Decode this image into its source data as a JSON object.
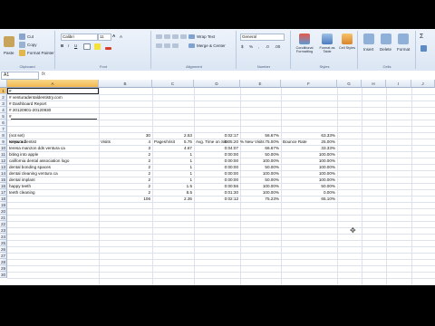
{
  "ribbon": {
    "clipboard": {
      "paste": "Paste",
      "cut": "Cut",
      "copy": "Copy",
      "format_painter": "Format Painter",
      "label": "Clipboard"
    },
    "font": {
      "name": "Calibri",
      "size": "11",
      "label": "Font"
    },
    "alignment": {
      "wrap_text": "Wrap Text",
      "merge_center": "Merge & Center",
      "label": "Alignment"
    },
    "number": {
      "format": "General",
      "label": "Number"
    },
    "styles": {
      "conditional": "Conditional Formatting",
      "format_table": "Format as Table",
      "cell_styles": "Cell Styles",
      "label": "Styles"
    },
    "cells": {
      "insert": "Insert",
      "delete": "Delete",
      "format": "Format",
      "label": "Cells"
    }
  },
  "formula_bar": {
    "name_box": "A1",
    "fx": "fx"
  },
  "columns": [
    "A",
    "B",
    "C",
    "D",
    "E",
    "F",
    "G",
    "H",
    "I",
    "J"
  ],
  "rows": [
    "1",
    "2",
    "3",
    "4",
    "5",
    "6",
    "7",
    "8",
    "9",
    "10",
    "11",
    "12",
    "13",
    "14",
    "15",
    "16",
    "17",
    "18",
    "19",
    "20",
    "21",
    "22",
    "23",
    "24",
    "25",
    "26",
    "27",
    "28",
    "29",
    "30"
  ],
  "meta_lines": {
    "r1": "#",
    "r2": "# venturadentaldentistry.com",
    "r3": "# Dashboard Report",
    "r4": "# 20120901-20120930",
    "r5": "#"
  },
  "table": {
    "headers": [
      "Keyword",
      "Visits",
      "Pages/Visit",
      "Avg. Time on Site",
      "% New Visits",
      "Bounce Rate"
    ],
    "rows": [
      [
        "(not set)",
        "30",
        "2.53",
        "0:02:17",
        "56.67%",
        "63.33%"
      ],
      [
        "ventura dentist",
        "4",
        "5.75",
        "0:05:20",
        "75.00%",
        "25.00%"
      ],
      [
        "teresa manzon dds ventura ca",
        "3",
        "4.67",
        "0:04:07",
        "66.67%",
        "33.33%"
      ],
      [
        "biting into apple",
        "2",
        "1",
        "0:00:00",
        "50.00%",
        "100.00%"
      ],
      [
        "california dental association logo",
        "2",
        "1",
        "0:00:00",
        "100.00%",
        "100.00%"
      ],
      [
        "dental bonding spaces",
        "2",
        "1",
        "0:00:00",
        "50.00%",
        "100.00%"
      ],
      [
        "dental cleaning ventura ca",
        "2",
        "1",
        "0:00:00",
        "100.00%",
        "100.00%"
      ],
      [
        "dental implant",
        "2",
        "1",
        "0:00:00",
        "50.00%",
        "100.00%"
      ],
      [
        "happy teeth",
        "2",
        "1.5",
        "0:00:56",
        "100.00%",
        "50.00%"
      ],
      [
        "teeth cleaning",
        "2",
        "8.5",
        "0:01:30",
        "100.00%",
        "0.00%"
      ]
    ],
    "total": [
      "",
      "106",
      "2.35",
      "0:02:12",
      "75.23%",
      "65.10%"
    ]
  }
}
